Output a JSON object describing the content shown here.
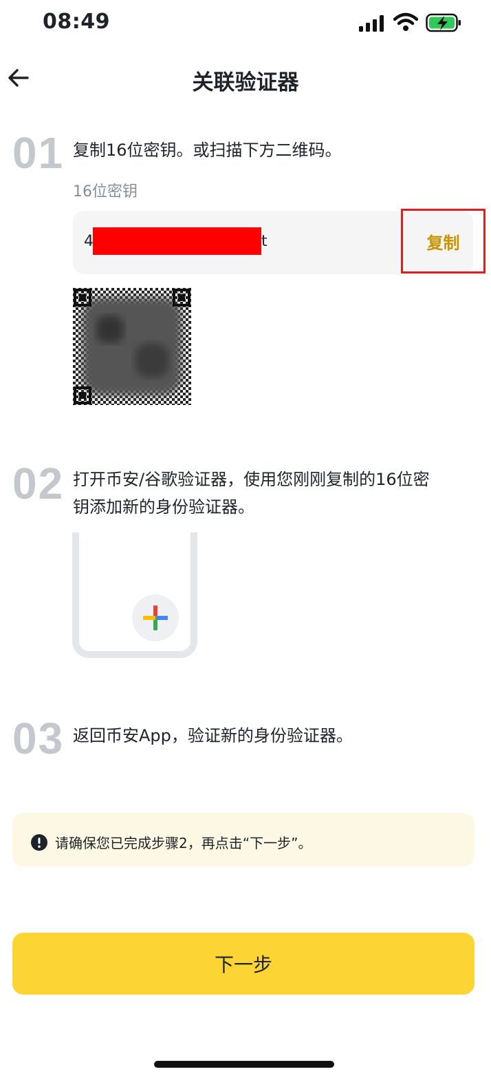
{
  "status_bar": {
    "time": "08:49"
  },
  "header": {
    "title": "关联验证器"
  },
  "steps": [
    {
      "number": "01",
      "text": "复制16位密钥。或扫描下方二维码。"
    },
    {
      "number": "02",
      "text_line1": "打开币安/谷歌验证器，使用您刚刚复制的16位密",
      "text_line2": "钥添加新的身份验证器。"
    },
    {
      "number": "03",
      "text": "返回币安App，验证新的身份验证器。"
    }
  ],
  "key": {
    "label": "16位密钥",
    "prefix": "4",
    "suffix": "t",
    "copy_label": "复制"
  },
  "notice": {
    "text": "请确保您已完成步骤2，再点击“下一步”。"
  },
  "footer": {
    "next_label": "下一步"
  },
  "colors": {
    "accent": "#fcd535",
    "copy_text": "#c99400",
    "highlight_border": "#e51c1c",
    "redaction": "#ff0000",
    "notice_bg": "#fcf8e3"
  }
}
